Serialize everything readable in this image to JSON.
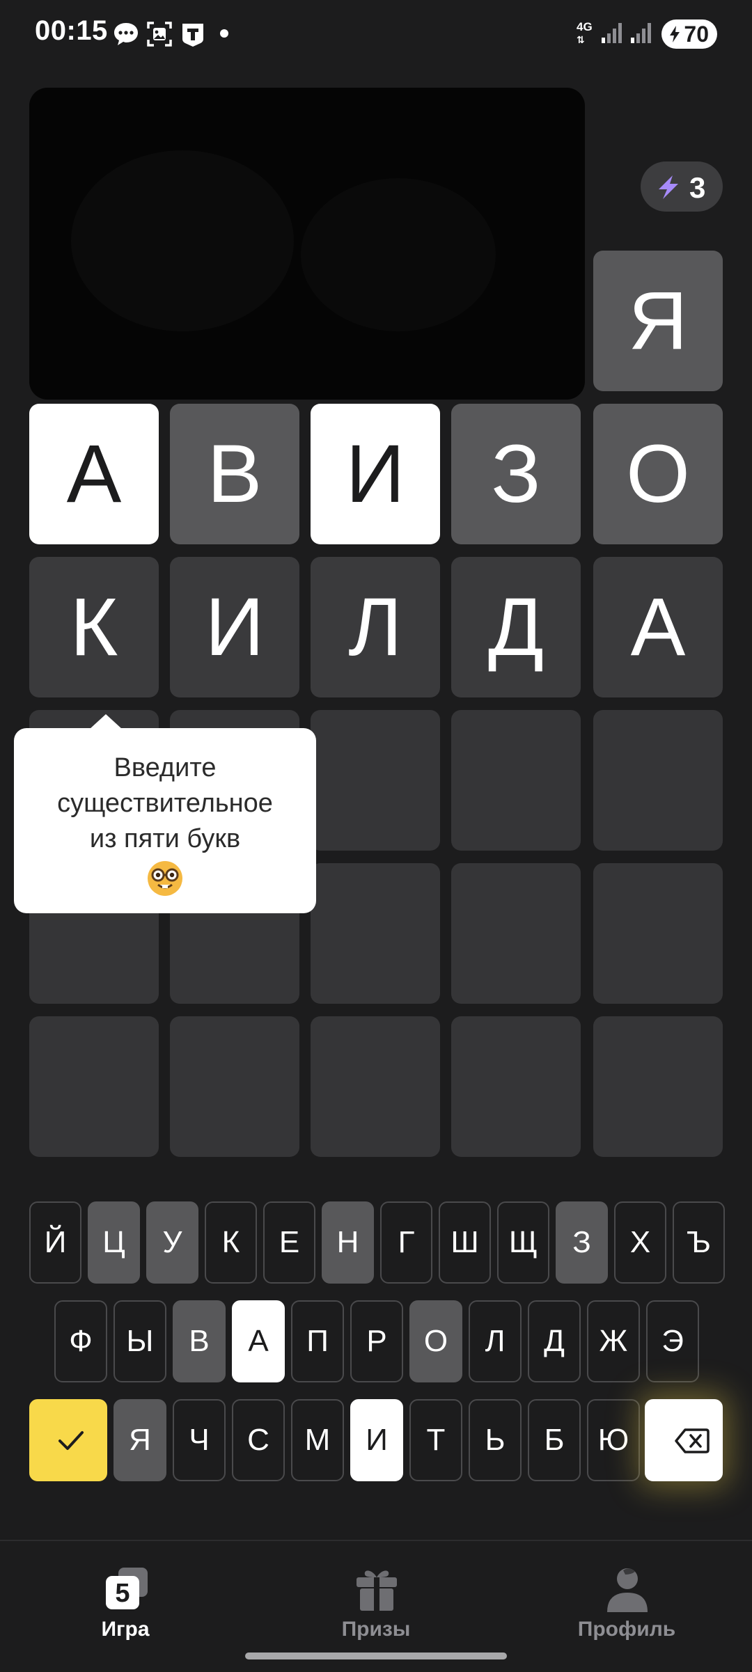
{
  "status_bar": {
    "time": "00:15",
    "network": "4G",
    "battery": "70",
    "icons": [
      "message-icon",
      "photo-icon",
      "news-app-icon",
      "signal-icon",
      "battery-charging-icon"
    ]
  },
  "hints": {
    "count": "3",
    "icon": "lightning-icon"
  },
  "board": {
    "revealed_tile": "Я",
    "rows": [
      [
        {
          "letter": "А",
          "state": "correct"
        },
        {
          "letter": "В",
          "state": "present"
        },
        {
          "letter": "И",
          "state": "correct"
        },
        {
          "letter": "З",
          "state": "present"
        },
        {
          "letter": "О",
          "state": "present"
        }
      ],
      [
        {
          "letter": "К",
          "state": "absent"
        },
        {
          "letter": "И",
          "state": "absent"
        },
        {
          "letter": "Л",
          "state": "absent"
        },
        {
          "letter": "Д",
          "state": "absent"
        },
        {
          "letter": "А",
          "state": "absent"
        }
      ]
    ]
  },
  "tooltip": {
    "line1": "Введите",
    "line2": "существительное",
    "line3": "из пяти букв",
    "emoji": "nerd-face-icon"
  },
  "keyboard": {
    "row1": [
      "Й",
      "Ц",
      "У",
      "К",
      "Е",
      "Н",
      "Г",
      "Ш",
      "Щ",
      "З",
      "Х",
      "Ъ"
    ],
    "row2": [
      "Ф",
      "Ы",
      "В",
      "А",
      "П",
      "Р",
      "О",
      "Л",
      "Д",
      "Ж",
      "Э"
    ],
    "row3": [
      "Я",
      "Ч",
      "С",
      "М",
      "И",
      "Т",
      "Ь",
      "Б",
      "Ю"
    ],
    "present_keys": [
      "Ц",
      "У",
      "Н",
      "З",
      "В",
      "О",
      "Я"
    ],
    "correct_keys": [
      "А",
      "И"
    ],
    "enter_icon": "checkmark-icon",
    "backspace_icon": "backspace-icon",
    "accent_color": "#f8d94a"
  },
  "bottom_nav": {
    "items": [
      {
        "label": "Игра",
        "icon": "game-icon",
        "active": true
      },
      {
        "label": "Призы",
        "icon": "gift-icon",
        "active": false
      },
      {
        "label": "Профиль",
        "icon": "profile-icon",
        "active": false
      }
    ]
  }
}
